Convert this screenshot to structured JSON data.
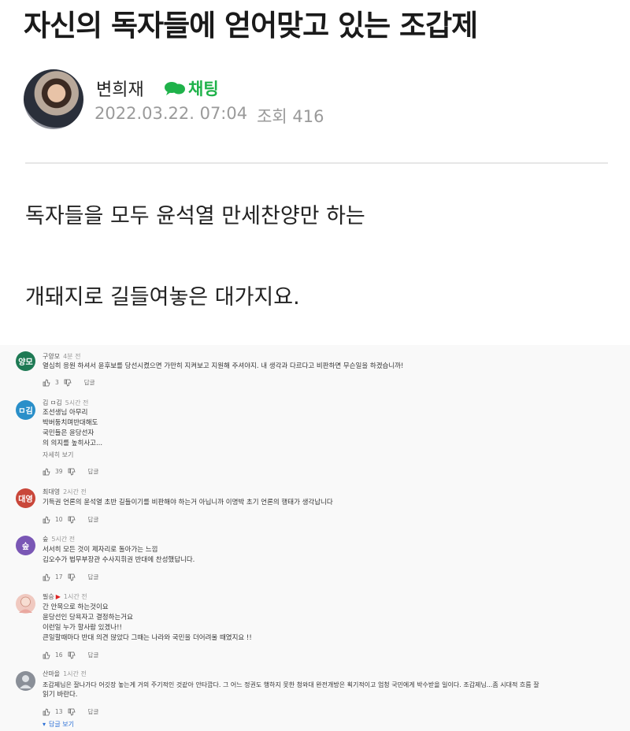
{
  "article": {
    "title": "자신의 독자들에 얻어맞고 있는 조갑제",
    "author": "변희재",
    "chat_label": "채팅",
    "date": "2022.03.22. 07:04",
    "views": "조회 416",
    "body": [
      "독자들을 모두 윤석열 만세찬양만 하는",
      "개돼지로 길들여놓은 대가지요."
    ]
  },
  "comments": [
    {
      "avatar_text": "양모",
      "avatar_color": "#1e7a54",
      "author": "구양모",
      "time": "4분 전",
      "lines": [
        "열심히 응원 하셔서 윤후보를 당선시켰으면 가만히 지켜보고 지원해 주셔야지. 내 생각과 다르다고 비판하면 무슨일을 하겠습니까!"
      ],
      "likes": "3",
      "reply_label": "답글"
    },
    {
      "avatar_text": "ㅁ김",
      "avatar_color": "#2a8fc9",
      "author": "김 ㅁ김",
      "time": "5시간 전",
      "lines": [
        "조선생님 아무리",
        "박버둥치며반대해도",
        "국민들은 윤당선자",
        "의 의지를 높히사고..."
      ],
      "more": "자세히 보기",
      "likes": "39",
      "reply_label": "답글"
    },
    {
      "avatar_text": "대영",
      "avatar_color": "#c9473a",
      "author": "최대영",
      "time": "2시간 전",
      "lines": [
        "기득권 언론의 윤석열 초반 길들이기를 비판해야 하는거 아닙니까 이명박 초기 언론의 행태가 생각납니다"
      ],
      "likes": "10",
      "reply_label": "답글"
    },
    {
      "avatar_text": "숲",
      "avatar_color": "#7a57b5",
      "author": "숲",
      "time": "5시간 전",
      "lines": [
        "서서히 모든 것이 제자리로 돌아가는 느낌",
        "김오수가 법무부장관 수사지휘권 반대에 찬성했답니다."
      ],
      "likes": "17",
      "reply_label": "답글"
    },
    {
      "avatar_text": "",
      "avatar_color": "#f0c9c0",
      "author": "필승",
      "time": "1시간 전",
      "lines": [
        "간 안목으로 하는것이요",
        "윤당선인 당욕자고 결정하는거요",
        "이런일 누가 할사람 있겠나!!",
        "큰일할때마다 반대 의견 많았다 그때는 나라와 국민을 더어려울 때였지요 !!"
      ],
      "likes": "16",
      "reply_label": "답글"
    },
    {
      "avatar_text": "",
      "avatar_color": "#8a8f98",
      "author": "산마을",
      "time": "1시간 전",
      "lines": [
        "조갑제님은 잘나가다 어깃장 놓는게 거의 주기적인 것같아 안타깝다. 그 어느 정권도 행하지 못한 청와대 완전개방은 획기적이고 엄청 국민에게 박수받을 일이다. 조갑제님...좀 시대적 흐름 잘",
        "읽기 바란다."
      ],
      "likes": "13",
      "reply_label": "답글",
      "replies_label": "답글 보기"
    }
  ],
  "colors": {
    "chat_green": "#1fb24a",
    "link_blue": "#2a6fd6",
    "meta_gray": "#9a9a9a"
  }
}
